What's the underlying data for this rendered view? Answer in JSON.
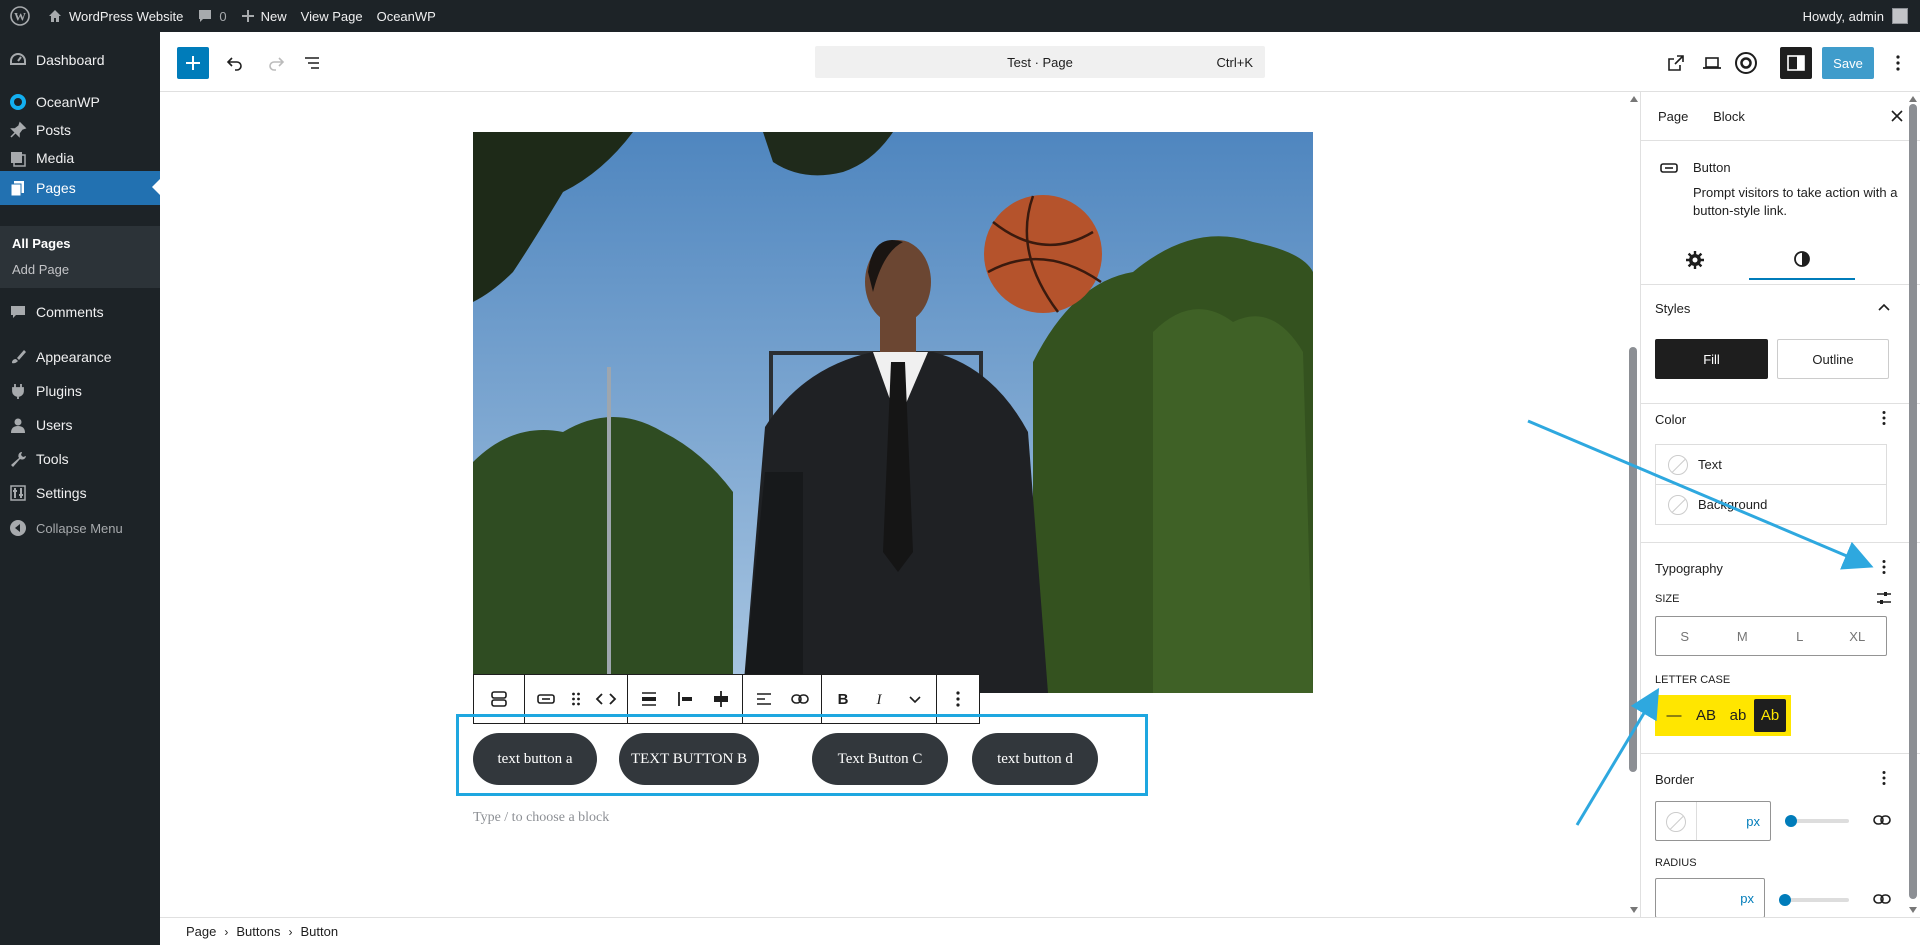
{
  "admin_bar": {
    "site_name": "WordPress Website",
    "comments_count": "0",
    "new_label": "New",
    "view_page_label": "View Page",
    "theme_label": "OceanWP",
    "greeting": "Howdy, admin"
  },
  "sidebar": {
    "items": [
      {
        "label": "Dashboard",
        "icon": "dashboard-icon"
      },
      {
        "label": "OceanWP",
        "icon": "oceanwp-icon"
      },
      {
        "label": "Posts",
        "icon": "pin-icon"
      },
      {
        "label": "Media",
        "icon": "media-icon"
      },
      {
        "label": "Pages",
        "icon": "pages-icon"
      },
      {
        "label": "Comments",
        "icon": "comment-icon"
      },
      {
        "label": "Appearance",
        "icon": "brush-icon"
      },
      {
        "label": "Plugins",
        "icon": "plug-icon"
      },
      {
        "label": "Users",
        "icon": "user-icon"
      },
      {
        "label": "Tools",
        "icon": "wrench-icon"
      },
      {
        "label": "Settings",
        "icon": "settings-icon"
      }
    ],
    "submenu": [
      "All Pages",
      "Add Page"
    ],
    "collapse_label": "Collapse Menu"
  },
  "editor": {
    "command_bar": "Test · Page",
    "shortcut": "Ctrl+K",
    "save_label": "Save"
  },
  "content": {
    "buttons": [
      "text button a",
      "TEXT BUTTON B",
      "Text Button C",
      "text button d"
    ],
    "placeholder": "Type / to choose a block"
  },
  "inspector": {
    "tabs": [
      "Page",
      "Block"
    ],
    "block_title": "Button",
    "block_desc": "Prompt visitors to take action with a button-style link.",
    "styles": {
      "title": "Styles",
      "options": [
        "Fill",
        "Outline"
      ]
    },
    "color": {
      "title": "Color",
      "items": [
        "Text",
        "Background"
      ]
    },
    "typography": {
      "title": "Typography",
      "size_label": "SIZE",
      "sizes": [
        "S",
        "M",
        "L",
        "XL"
      ],
      "letter_case_label": "LETTER CASE",
      "cases": [
        "—",
        "AB",
        "ab",
        "Ab"
      ]
    },
    "border": {
      "title": "Border",
      "unit": "px",
      "radius_label": "RADIUS",
      "radius_unit": "px"
    }
  },
  "breadcrumb": [
    "Page",
    "Buttons",
    "Button"
  ],
  "colors": {
    "accent": "#007cba",
    "highlight": "#ffe600",
    "annotation": "#2ea8df",
    "block_outline": "#1ea7e0"
  }
}
